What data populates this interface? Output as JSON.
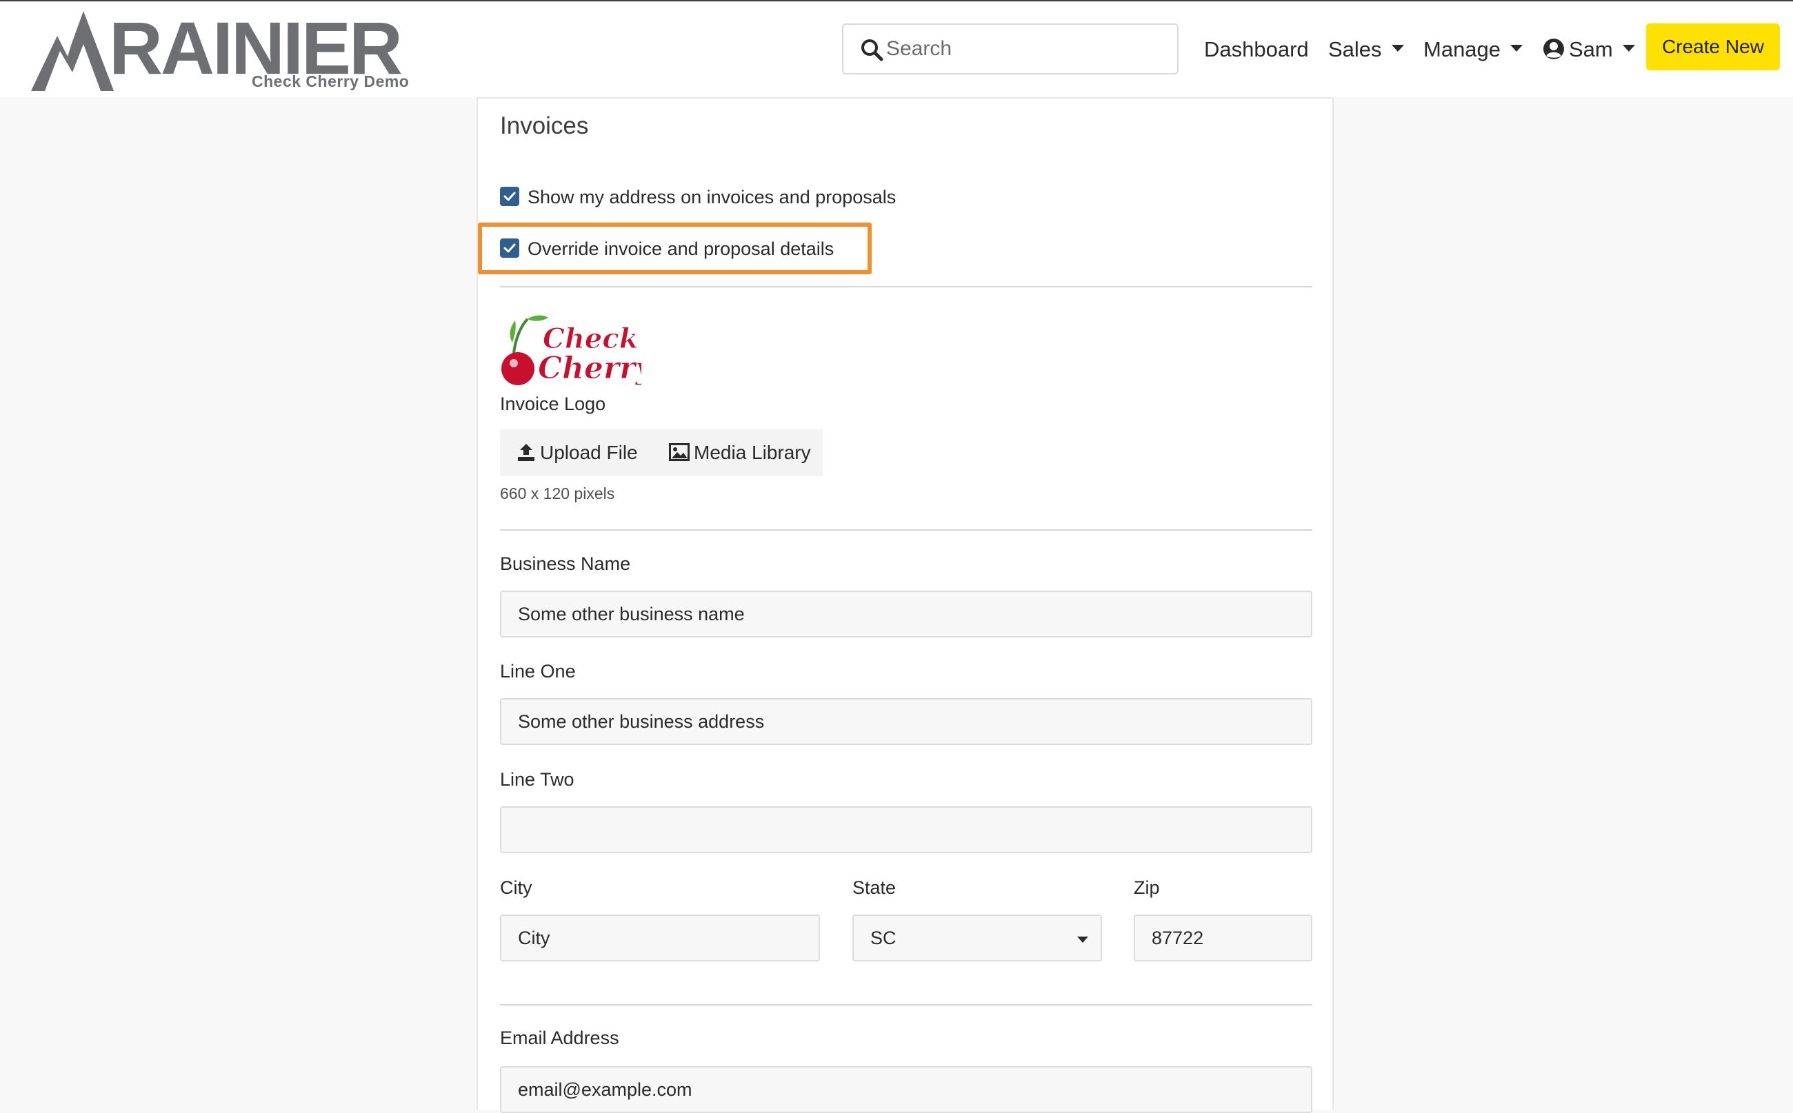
{
  "header": {
    "logo_text": "RAINIER",
    "logo_subtitle": "Check Cherry Demo",
    "search_placeholder": "Search",
    "nav": {
      "dashboard": "Dashboard",
      "sales": "Sales",
      "manage": "Manage",
      "user": "Sam"
    },
    "create_new": "Create New"
  },
  "invoices": {
    "title": "Invoices",
    "show_address_label": "Show my address on invoices and proposals",
    "show_address_checked": true,
    "override_label": "Override invoice and proposal details",
    "override_checked": true,
    "logo_caption": "Invoice Logo",
    "logo_text_line1": "Check",
    "logo_text_line2": "Cherry",
    "upload_file": "Upload File",
    "media_library": "Media Library",
    "logo_size_hint": "660 x 120 pixels",
    "business_name_label": "Business Name",
    "business_name_value": "Some other business name",
    "line_one_label": "Line One",
    "line_one_value": "Some other business address",
    "line_two_label": "Line Two",
    "line_two_value": "",
    "city_label": "City",
    "city_value": "City",
    "state_label": "State",
    "state_value": "SC",
    "zip_label": "Zip",
    "zip_value": "87722",
    "email_label": "Email Address",
    "email_value": "email@example.com"
  },
  "colors": {
    "accent_yellow": "#ffe100",
    "highlight_orange": "#ef8f2e",
    "checkbox_blue": "#2f5f8f",
    "logo_gray": "#6d6f73"
  }
}
